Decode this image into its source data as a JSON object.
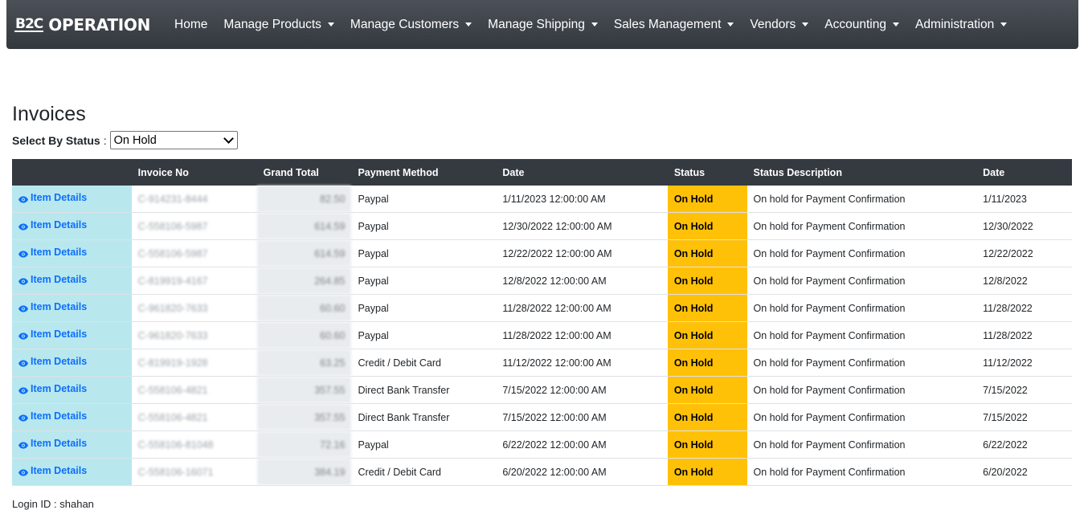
{
  "navbar": {
    "logo_text": "B2C",
    "brand": "OPERATION",
    "items": [
      {
        "label": "Home",
        "dropdown": false
      },
      {
        "label": "Manage Products",
        "dropdown": true
      },
      {
        "label": "Manage Customers",
        "dropdown": true
      },
      {
        "label": "Manage Shipping",
        "dropdown": true
      },
      {
        "label": "Sales Management",
        "dropdown": true
      },
      {
        "label": "Vendors",
        "dropdown": true
      },
      {
        "label": "Accounting",
        "dropdown": true
      },
      {
        "label": "Administration",
        "dropdown": true
      }
    ]
  },
  "page": {
    "title": "Invoices",
    "filter_label": "Select By Status",
    "filter_separator": ":",
    "filter_value": "On Hold"
  },
  "table": {
    "headers": [
      "",
      "Invoice No",
      "Grand Total",
      "Payment Method",
      "Date",
      "Status",
      "Status Description",
      "Date"
    ],
    "rows": [
      {
        "link": "Item Details",
        "invoice": "C-914231-8444",
        "total": "82.50",
        "method": "Paypal",
        "date": "1/11/2023 12:00:00 AM",
        "status": "On Hold",
        "desc": "On hold for Payment Confirmation",
        "short_date": "1/11/2023"
      },
      {
        "link": "Item Details",
        "invoice": "C-558106-5987",
        "total": "614.59",
        "method": "Paypal",
        "date": "12/30/2022 12:00:00 AM",
        "status": "On Hold",
        "desc": "On hold for Payment Confirmation",
        "short_date": "12/30/2022"
      },
      {
        "link": "Item Details",
        "invoice": "C-558106-5987",
        "total": "614.59",
        "method": "Paypal",
        "date": "12/22/2022 12:00:00 AM",
        "status": "On Hold",
        "desc": "On hold for Payment Confirmation",
        "short_date": "12/22/2022"
      },
      {
        "link": "Item Details",
        "invoice": "C-819919-4167",
        "total": "264.85",
        "method": "Paypal",
        "date": "12/8/2022 12:00:00 AM",
        "status": "On Hold",
        "desc": "On hold for Payment Confirmation",
        "short_date": "12/8/2022"
      },
      {
        "link": "Item Details",
        "invoice": "C-961820-7633",
        "total": "60.60",
        "method": "Paypal",
        "date": "11/28/2022 12:00:00 AM",
        "status": "On Hold",
        "desc": "On hold for Payment Confirmation",
        "short_date": "11/28/2022"
      },
      {
        "link": "Item Details",
        "invoice": "C-961820-7633",
        "total": "60.60",
        "method": "Paypal",
        "date": "11/28/2022 12:00:00 AM",
        "status": "On Hold",
        "desc": "On hold for Payment Confirmation",
        "short_date": "11/28/2022"
      },
      {
        "link": "Item Details",
        "invoice": "C-819919-1928",
        "total": "63.25",
        "method": "Credit / Debit Card",
        "date": "11/12/2022 12:00:00 AM",
        "status": "On Hold",
        "desc": "On hold for Payment Confirmation",
        "short_date": "11/12/2022"
      },
      {
        "link": "Item Details",
        "invoice": "C-558106-4821",
        "total": "357.55",
        "method": "Direct Bank Transfer",
        "date": "7/15/2022 12:00:00 AM",
        "status": "On Hold",
        "desc": "On hold for Payment Confirmation",
        "short_date": "7/15/2022"
      },
      {
        "link": "Item Details",
        "invoice": "C-558106-4821",
        "total": "357.55",
        "method": "Direct Bank Transfer",
        "date": "7/15/2022 12:00:00 AM",
        "status": "On Hold",
        "desc": "On hold for Payment Confirmation",
        "short_date": "7/15/2022"
      },
      {
        "link": "Item Details",
        "invoice": "C-558106-81048",
        "total": "72.16",
        "method": "Paypal",
        "date": "6/22/2022 12:00:00 AM",
        "status": "On Hold",
        "desc": "On hold for Payment Confirmation",
        "short_date": "6/22/2022"
      },
      {
        "link": "Item Details",
        "invoice": "C-558106-16071",
        "total": "384.19",
        "method": "Credit / Debit Card",
        "date": "6/20/2022 12:00:00 AM",
        "status": "On Hold",
        "desc": "On hold for Payment Confirmation",
        "short_date": "6/20/2022"
      }
    ]
  },
  "footer": {
    "login_text": "Login ID : shahan"
  },
  "colors": {
    "navbar": "#3d4248",
    "detail_cell": "#b8e8ee",
    "status_cell": "#ffc107",
    "link": "#0d6efd",
    "header": "#343a40"
  }
}
